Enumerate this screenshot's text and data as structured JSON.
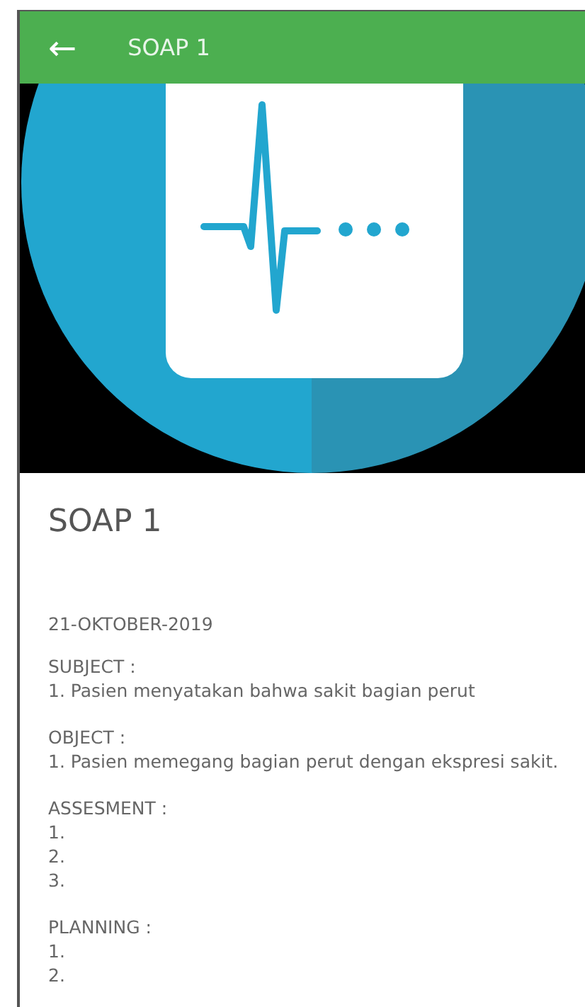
{
  "app_bar": {
    "back": "←",
    "title": "SOAP 1"
  },
  "title": "SOAP 1",
  "date": "21-OKTOBER-2019",
  "sections": [
    {
      "heading": "SUBJECT :",
      "lines": [
        "1. Pasien menyatakan bahwa sakit bagian perut"
      ]
    },
    {
      "heading": "OBJECT :",
      "lines": [
        "1. Pasien memegang bagian perut dengan ekspresi sakit."
      ]
    },
    {
      "heading": "ASSESMENT :",
      "lines": [
        "1.",
        "2.",
        "3."
      ]
    },
    {
      "heading": "PLANNING :",
      "lines": [
        "1.",
        "2."
      ]
    }
  ]
}
